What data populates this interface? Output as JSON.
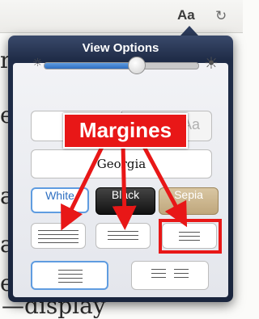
{
  "toolbar": {
    "font_button": "Aa",
    "refresh_icon": "refresh-icon",
    "icon_glyph": "↻"
  },
  "book_text": [
    "r",
    "e",
    "a",
    "a",
    "e",
    "—display"
  ],
  "popover": {
    "title": "View Options",
    "brightness": {
      "level": 0.6,
      "low_icon": "sun-small-icon",
      "high_icon": "sun-large-icon",
      "low_glyph": "☼",
      "high_glyph": "☀"
    },
    "font_size": {
      "large_label": "Aa"
    },
    "font": {
      "label": "Georgia"
    },
    "themes": [
      "White",
      "Black",
      "Sepia"
    ],
    "selected_theme": "White",
    "margins": [
      "narrow",
      "medium",
      "wide"
    ],
    "layouts": [
      "single-column",
      "two-column"
    ]
  },
  "annotation": {
    "label": "Margines",
    "color": "#e81717"
  }
}
